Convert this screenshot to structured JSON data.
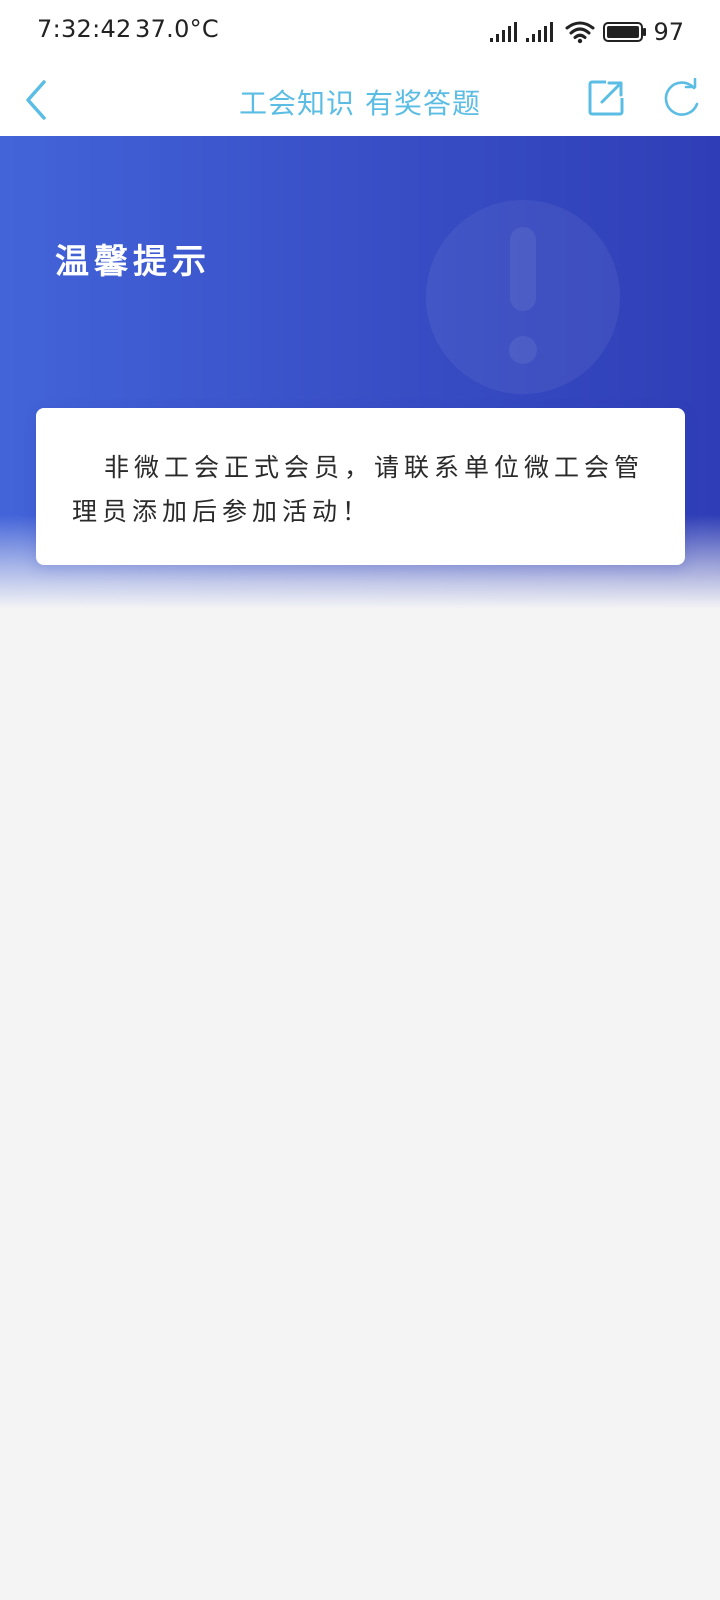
{
  "status_bar": {
    "time": "7:32:42",
    "temperature": "37.0°C",
    "battery_level": "97",
    "icons": [
      "signal-icon",
      "signal-icon",
      "wifi-icon",
      "battery-icon"
    ]
  },
  "nav": {
    "title": "工会知识 有奖答题",
    "icons": [
      "back-arrow-icon",
      "share-icon",
      "refresh-icon"
    ],
    "accent_color": "#5bbde3"
  },
  "hero": {
    "title": "温馨提示",
    "decoration_icon": "exclamation-icon",
    "colors": {
      "gradient_start": "#4364d9",
      "gradient_end": "#2f3eb6"
    }
  },
  "notice": {
    "message": "非微工会正式会员，请联系单位微工会管理员添加后参加活动！"
  },
  "page": {
    "background_color": "#f4f4f5"
  }
}
